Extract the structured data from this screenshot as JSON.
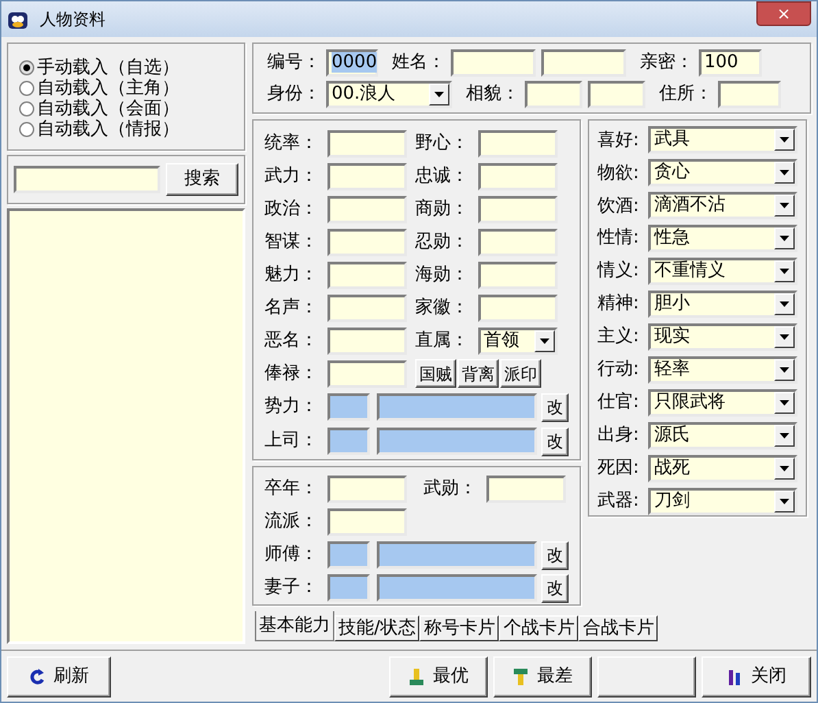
{
  "window": {
    "title": "人物资料",
    "buttons": [
      "×"
    ]
  },
  "load_modes": [
    {
      "label": "手动载入（自选）",
      "selected": true
    },
    {
      "label": "自动载入（主角）",
      "selected": false
    },
    {
      "label": "自动载入（会面）",
      "selected": false
    },
    {
      "label": "自动载入（情报）",
      "selected": false
    }
  ],
  "search": {
    "button": "搜索"
  },
  "header": {
    "rows": [
      [
        {
          "label": "编号：",
          "fields": [
            {
              "value": "0000",
              "selected": true
            }
          ]
        },
        {
          "label": "姓名：",
          "fields": [
            {
              "selected": false
            },
            {
              "selected": false
            }
          ]
        },
        {
          "label": "亲密：",
          "fields": [
            {
              "value": "100",
              "selected": false
            }
          ]
        }
      ],
      [
        {
          "label": "身份：",
          "dropdown": "00.浪人"
        },
        {
          "label": "相貌：",
          "fields": [
            {
              "selected": false
            },
            {
              "selected": false
            }
          ]
        },
        {
          "label": "住所：",
          "fields": [
            {
              "selected": false
            }
          ]
        }
      ]
    ]
  },
  "abilities": {
    "left": [
      "统率：",
      "武力：",
      "政治：",
      "智谋：",
      "魅力：",
      "名声：",
      "恶名：",
      "俸禄："
    ],
    "right": [
      {
        "kind": "field",
        "label": "野心："
      },
      {
        "kind": "field",
        "label": "忠诚："
      },
      {
        "kind": "field",
        "label": "商勋："
      },
      {
        "kind": "field",
        "label": "忍勋："
      },
      {
        "kind": "field",
        "label": "海勋："
      },
      {
        "kind": "field",
        "label": "家徽："
      },
      {
        "kind": "select",
        "label": "直属：",
        "value": "首领"
      }
    ],
    "buttons": [
      "国贼",
      "背离",
      "派印"
    ],
    "links": [
      {
        "label": "势力：",
        "button": "改"
      },
      {
        "label": "上司：",
        "button": "改"
      }
    ]
  },
  "personality": [
    {
      "label": "喜好:",
      "value": "武具"
    },
    {
      "label": "物欲:",
      "value": "贪心"
    },
    {
      "label": "饮酒:",
      "value": "滴酒不沾"
    },
    {
      "label": "性情:",
      "value": "性急"
    },
    {
      "label": "情义:",
      "value": "不重情义"
    },
    {
      "label": "精神:",
      "value": "胆小"
    },
    {
      "label": "主义:",
      "value": "现实"
    },
    {
      "label": "行动:",
      "value": "轻率"
    },
    {
      "label": "仕官:",
      "value": "只限武将"
    },
    {
      "label": "出身:",
      "value": "源氏"
    },
    {
      "label": "死因:",
      "value": "战死"
    },
    {
      "label": "武器:",
      "value": "刀剑"
    }
  ],
  "details": {
    "death_year": "卒年：",
    "merit": "武勋：",
    "school": "流派：",
    "links": [
      {
        "label": "师傅：",
        "button": "改"
      },
      {
        "label": "妻子：",
        "button": "改"
      }
    ]
  },
  "tabs": [
    {
      "label": "基本能力",
      "selected": true
    },
    {
      "label": "技能/状态",
      "selected": false
    },
    {
      "label": "称号卡片",
      "selected": false
    },
    {
      "label": "个战卡片",
      "selected": false
    },
    {
      "label": "合战卡片",
      "selected": false
    }
  ],
  "footer": {
    "refresh": "刷新",
    "best": "最优",
    "worst": "最差",
    "close": "关闭"
  }
}
